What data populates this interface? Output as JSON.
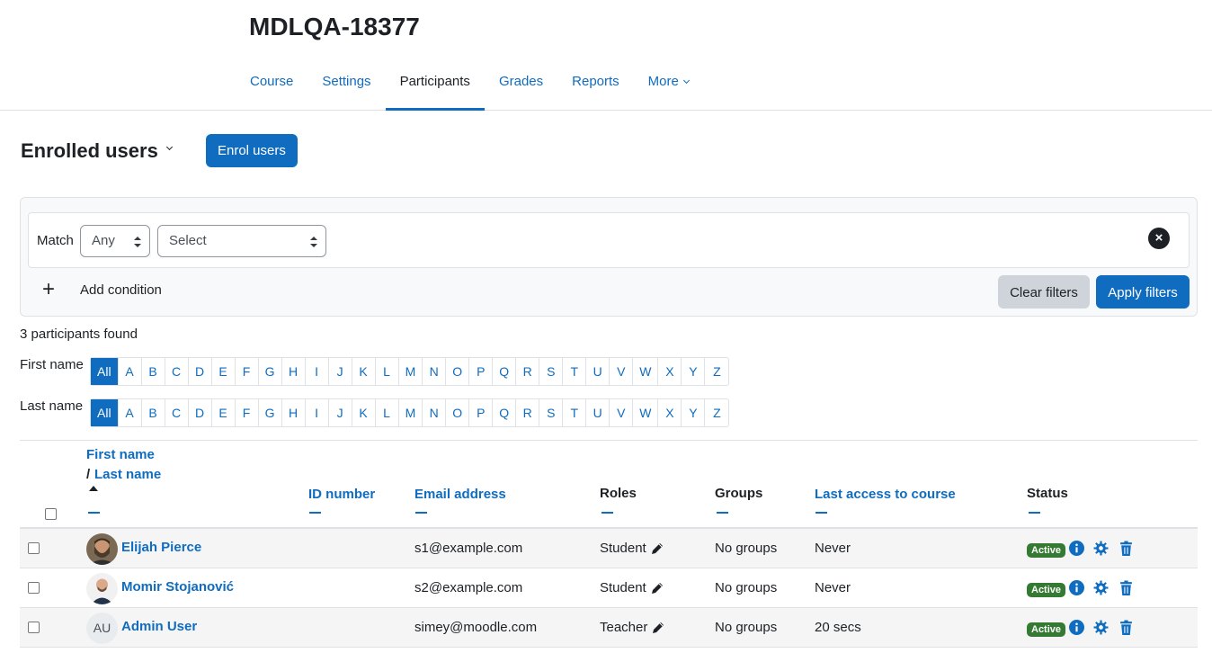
{
  "course": {
    "title": "MDLQA-18377"
  },
  "nav": {
    "items": [
      {
        "label": "Course"
      },
      {
        "label": "Settings"
      },
      {
        "label": "Participants"
      },
      {
        "label": "Grades"
      },
      {
        "label": "Reports"
      },
      {
        "label": "More"
      }
    ],
    "active": "Participants"
  },
  "page": {
    "heading": "Enrolled users",
    "enrol_button": "Enrol users"
  },
  "filters": {
    "match_label": "Match",
    "match_value": "Any",
    "type_value": "Select",
    "add_condition": "Add condition",
    "clear_label": "Clear filters",
    "apply_label": "Apply filters"
  },
  "participants_count": "3 participants found",
  "initials": {
    "first_label": "First name",
    "last_label": "Last name",
    "letters": [
      "All",
      "A",
      "B",
      "C",
      "D",
      "E",
      "F",
      "G",
      "H",
      "I",
      "J",
      "K",
      "L",
      "M",
      "N",
      "O",
      "P",
      "Q",
      "R",
      "S",
      "T",
      "U",
      "V",
      "W",
      "X",
      "Y",
      "Z"
    ],
    "selected": "All"
  },
  "table": {
    "headers": {
      "first_name": "First name",
      "slash": "/",
      "last_name": "Last name",
      "id_number": "ID number",
      "email": "Email address",
      "roles": "Roles",
      "groups": "Groups",
      "last_access": "Last access to course",
      "status": "Status"
    },
    "rows": [
      {
        "name": "Elijah Pierce",
        "avatar": "photo-bearded-man",
        "email": "s1@example.com",
        "role": "Student",
        "groups": "No groups",
        "last_access": "Never",
        "status": "Active"
      },
      {
        "name": "Momir Stojanović",
        "avatar": "photo-bald-man",
        "email": "s2@example.com",
        "role": "Student",
        "groups": "No groups",
        "last_access": "Never",
        "status": "Active"
      },
      {
        "name": "Admin User",
        "avatar_initials": "AU",
        "email": "simey@moodle.com",
        "role": "Teacher",
        "groups": "No groups",
        "last_access": "20 secs",
        "status": "Active"
      }
    ]
  },
  "icons": {
    "info": "info-icon",
    "gear": "gear-icon",
    "trash": "trash-icon",
    "edit": "pencil-icon",
    "remove": "close-circle-icon"
  },
  "colors": {
    "primary": "#0f6cbf",
    "active_badge": "#357a32",
    "secondary_button": "#ced4da"
  }
}
